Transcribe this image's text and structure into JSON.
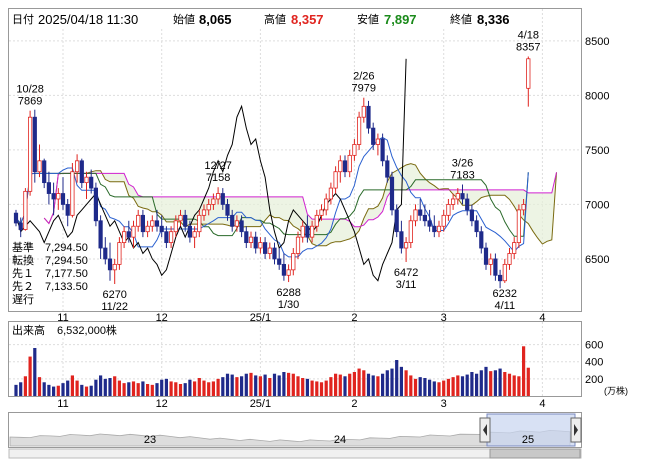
{
  "header": {
    "date_label": "日付",
    "date_value": "2025/04/18 11:30",
    "open_label": "始値",
    "open_value": "8,065",
    "high_label": "高値",
    "high_value": "8,357",
    "low_label": "安値",
    "low_value": "7,897",
    "close_label": "終値",
    "close_value": "8,336"
  },
  "colors": {
    "up": "#e0241f",
    "down": "#1f2a8a",
    "high": "#e0241f",
    "low": "#1a8a1a",
    "base": "#2a6a2a",
    "conv": "#2a60d0",
    "lead1": "#7a6a10",
    "lead2": "#d020d0",
    "lag": "#000000"
  },
  "ichimoku_legend": [
    {
      "label": "基準",
      "value": "7,294.50",
      "color": "#2a6a2a"
    },
    {
      "label": "転換",
      "value": "7,294.50",
      "color": "#2a60d0"
    },
    {
      "label": "先１",
      "value": "7,177.50",
      "color": "#7a6a10"
    },
    {
      "label": "先２",
      "value": "7,133.50",
      "color": "#d020d0"
    },
    {
      "label": "遅行",
      "value": "",
      "color": "#000000"
    }
  ],
  "volume": {
    "label": "出来高",
    "value": "6,532,000株",
    "unit": "(万株)"
  },
  "navigator": {
    "labels": [
      "23",
      "24",
      "25"
    ]
  },
  "chart_data": {
    "type": "candlestick",
    "ylim": [
      6050,
      8600
    ],
    "yticks": [
      6500,
      7000,
      7500,
      8000,
      8500
    ],
    "x_ticks": [
      {
        "label": "11",
        "i": 10
      },
      {
        "label": "12",
        "i": 31
      },
      {
        "label": "25/1",
        "i": 52
      },
      {
        "label": "2",
        "i": 72
      },
      {
        "label": "3",
        "i": 91
      },
      {
        "label": "4",
        "i": 112
      }
    ],
    "annotations": [
      {
        "date": "10/28",
        "value": 7869
      },
      {
        "date": "11/22",
        "value": 6270
      },
      {
        "date": "12/27",
        "value": 7158
      },
      {
        "date": "1/30",
        "value": 6288
      },
      {
        "date": "2/26",
        "value": 7979
      },
      {
        "date": "3/11",
        "value": 6472
      },
      {
        "date": "3/26",
        "value": 7183
      },
      {
        "date": "4/11",
        "value": 6232
      },
      {
        "date": "4/18",
        "value": 8357
      }
    ],
    "volume_ylim": [
      0,
      700
    ],
    "volume_ticks": [
      200,
      400,
      600
    ],
    "ohlc": [
      [
        6920,
        6950,
        6800,
        6830
      ],
      [
        6830,
        6880,
        6700,
        6770
      ],
      [
        6770,
        7150,
        6760,
        7120
      ],
      [
        7120,
        7860,
        7080,
        7800
      ],
      [
        7800,
        7869,
        7200,
        7300
      ],
      [
        7300,
        7550,
        7250,
        7400
      ],
      [
        7400,
        7420,
        7150,
        7200
      ],
      [
        7200,
        7300,
        7000,
        7100
      ],
      [
        7100,
        7200,
        6900,
        7050
      ],
      [
        7050,
        7150,
        6950,
        7100
      ],
      [
        7100,
        7250,
        6950,
        7000
      ],
      [
        7000,
        7050,
        6800,
        6900
      ],
      [
        6900,
        7380,
        6880,
        7300
      ],
      [
        7300,
        7460,
        7200,
        7400
      ],
      [
        7400,
        7420,
        7150,
        7200
      ],
      [
        7200,
        7300,
        7050,
        7250
      ],
      [
        7250,
        7320,
        7100,
        7150
      ],
      [
        7150,
        7200,
        6800,
        6850
      ],
      [
        6850,
        6900,
        6500,
        6600
      ],
      [
        6600,
        6700,
        6450,
        6500
      ],
      [
        6500,
        6650,
        6300,
        6400
      ],
      [
        6400,
        6500,
        6270,
        6450
      ],
      [
        6450,
        6700,
        6400,
        6650
      ],
      [
        6650,
        6800,
        6600,
        6750
      ],
      [
        6750,
        6850,
        6650,
        6700
      ],
      [
        6700,
        6850,
        6600,
        6800
      ],
      [
        6800,
        6950,
        6750,
        6900
      ],
      [
        6900,
        6950,
        6700,
        6750
      ],
      [
        6750,
        6850,
        6700,
        6800
      ],
      [
        6800,
        6900,
        6750,
        6850
      ],
      [
        6850,
        6950,
        6750,
        6800
      ],
      [
        6800,
        6900,
        6700,
        6750
      ],
      [
        6750,
        6800,
        6600,
        6650
      ],
      [
        6650,
        6800,
        6600,
        6750
      ],
      [
        6750,
        6900,
        6700,
        6850
      ],
      [
        6850,
        6950,
        6800,
        6900
      ],
      [
        6900,
        6950,
        6750,
        6800
      ],
      [
        6800,
        6850,
        6650,
        6700
      ],
      [
        6700,
        6800,
        6600,
        6750
      ],
      [
        6750,
        6950,
        6700,
        6900
      ],
      [
        6900,
        7000,
        6850,
        6950
      ],
      [
        6950,
        7050,
        6900,
        7000
      ],
      [
        7000,
        7100,
        6950,
        7050
      ],
      [
        7050,
        7158,
        7000,
        7100
      ],
      [
        7100,
        7150,
        6950,
        7000
      ],
      [
        7000,
        7050,
        6850,
        6900
      ],
      [
        6900,
        6950,
        6750,
        6800
      ],
      [
        6800,
        6900,
        6750,
        6850
      ],
      [
        6850,
        6900,
        6700,
        6750
      ],
      [
        6750,
        6800,
        6600,
        6650
      ],
      [
        6650,
        6750,
        6600,
        6700
      ],
      [
        6700,
        6750,
        6550,
        6600
      ],
      [
        6600,
        6700,
        6550,
        6650
      ],
      [
        6650,
        6700,
        6500,
        6550
      ],
      [
        6550,
        6650,
        6500,
        6600
      ],
      [
        6600,
        6650,
        6450,
        6500
      ],
      [
        6500,
        6600,
        6400,
        6450
      ],
      [
        6450,
        6550,
        6300,
        6350
      ],
      [
        6350,
        6450,
        6288,
        6400
      ],
      [
        6400,
        6600,
        6350,
        6550
      ],
      [
        6550,
        6750,
        6500,
        6700
      ],
      [
        6700,
        6850,
        6650,
        6800
      ],
      [
        6800,
        6900,
        6650,
        6700
      ],
      [
        6700,
        6850,
        6650,
        6800
      ],
      [
        6800,
        6950,
        6750,
        6900
      ],
      [
        6900,
        7000,
        6850,
        6950
      ],
      [
        6950,
        7100,
        6900,
        7050
      ],
      [
        7050,
        7200,
        7000,
        7150
      ],
      [
        7150,
        7350,
        7100,
        7300
      ],
      [
        7300,
        7450,
        7200,
        7400
      ],
      [
        7400,
        7450,
        7250,
        7300
      ],
      [
        7300,
        7500,
        7250,
        7450
      ],
      [
        7450,
        7600,
        7400,
        7550
      ],
      [
        7550,
        7850,
        7500,
        7800
      ],
      [
        7800,
        7979,
        7750,
        7900
      ],
      [
        7900,
        7950,
        7650,
        7700
      ],
      [
        7700,
        7750,
        7500,
        7550
      ],
      [
        7550,
        7650,
        7450,
        7600
      ],
      [
        7600,
        7650,
        7350,
        7400
      ],
      [
        7400,
        7450,
        7200,
        7250
      ],
      [
        7250,
        7300,
        6900,
        6950
      ],
      [
        6950,
        7000,
        6700,
        6750
      ],
      [
        6750,
        6850,
        6550,
        6600
      ],
      [
        6600,
        6700,
        6472,
        6650
      ],
      [
        6650,
        6900,
        6600,
        6850
      ],
      [
        6850,
        7000,
        6800,
        6950
      ],
      [
        6950,
        7050,
        6850,
        6900
      ],
      [
        6900,
        7000,
        6800,
        6850
      ],
      [
        6850,
        6950,
        6750,
        6800
      ],
      [
        6800,
        6900,
        6700,
        6750
      ],
      [
        6750,
        6850,
        6700,
        6800
      ],
      [
        6800,
        6950,
        6750,
        6900
      ],
      [
        6900,
        7050,
        6850,
        7000
      ],
      [
        7000,
        7100,
        6950,
        7050
      ],
      [
        7050,
        7150,
        7000,
        7100
      ],
      [
        7100,
        7183,
        7000,
        7050
      ],
      [
        7050,
        7100,
        6900,
        6950
      ],
      [
        6950,
        7000,
        6800,
        6850
      ],
      [
        6850,
        6900,
        6700,
        6750
      ],
      [
        6750,
        6800,
        6550,
        6600
      ],
      [
        6600,
        6650,
        6400,
        6450
      ],
      [
        6450,
        6550,
        6350,
        6500
      ],
      [
        6500,
        6550,
        6300,
        6350
      ],
      [
        6350,
        6400,
        6232,
        6300
      ],
      [
        6300,
        6500,
        6280,
        6450
      ],
      [
        6450,
        6600,
        6400,
        6550
      ],
      [
        6550,
        6700,
        6500,
        6650
      ],
      [
        6650,
        7000,
        6600,
        6950
      ],
      [
        6950,
        7050,
        6900,
        7000
      ],
      [
        8065,
        8357,
        7897,
        8336
      ]
    ],
    "volume": [
      130,
      160,
      230,
      460,
      560,
      220,
      160,
      130,
      110,
      120,
      150,
      180,
      240,
      180,
      130,
      110,
      120,
      190,
      240,
      200,
      210,
      230,
      180,
      150,
      160,
      170,
      150,
      170,
      140,
      130,
      150,
      190,
      200,
      170,
      160,
      140,
      150,
      190,
      170,
      210,
      180,
      160,
      170,
      200,
      220,
      260,
      250,
      220,
      230,
      260,
      270,
      240,
      230,
      250,
      210,
      260,
      240,
      280,
      270,
      260,
      230,
      210,
      200,
      180,
      170,
      160,
      180,
      220,
      260,
      250,
      230,
      260,
      280,
      320,
      300,
      260,
      240,
      230,
      260,
      300,
      320,
      420,
      340,
      300,
      240,
      200,
      220,
      210,
      190,
      170,
      160,
      180,
      200,
      220,
      240,
      230,
      250,
      280,
      260,
      300,
      340,
      290,
      300,
      320,
      280,
      260,
      240,
      230,
      580,
      330
    ]
  }
}
